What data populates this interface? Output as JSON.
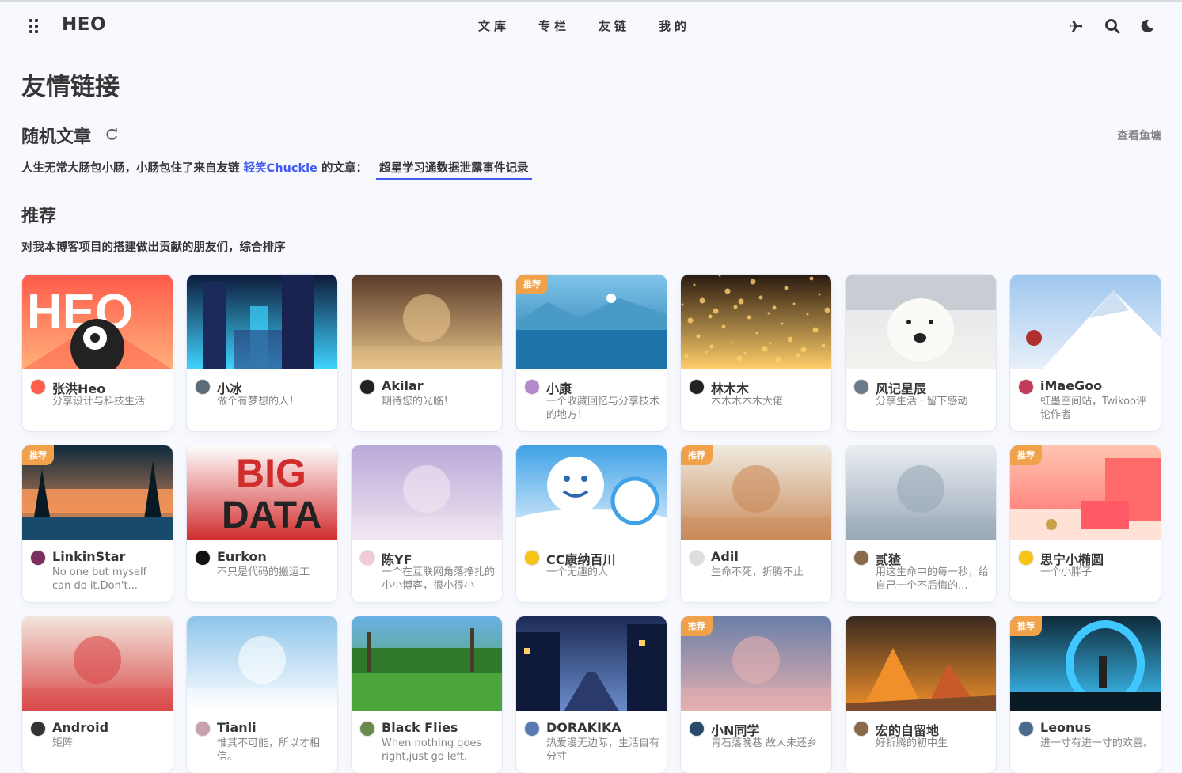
{
  "header": {
    "logo": "HEO",
    "nav": [
      "文库",
      "专栏",
      "友链",
      "我的"
    ]
  },
  "page": {
    "title": "友情链接",
    "random_section": {
      "title": "随机文章",
      "fish_link": "查看鱼塘",
      "line_prefix": "人生无常大肠包小肠，小肠包住了来自友链",
      "friend_name": "轻笑Chuckle",
      "line_mid": "的文章：",
      "article": "超星学习通数据泄露事件记录"
    },
    "recommend_section": {
      "title": "推荐",
      "desc": "对我本博客项目的搭建做出贡献的朋友们，综合排序"
    }
  },
  "badge_label": "推荐",
  "cards": [
    {
      "name": "张洪Heo",
      "desc": "分享设计与科技生活",
      "badge": false
    },
    {
      "name": "小冰",
      "desc": "做个有梦想的人！",
      "badge": false
    },
    {
      "name": "Akilar",
      "desc": "期待您的光临！",
      "badge": false
    },
    {
      "name": "小康",
      "desc": "一个收藏回忆与分享技术的地方！",
      "badge": true
    },
    {
      "name": "林木木",
      "desc": "木木木木木大佬",
      "badge": false
    },
    {
      "name": "风记星辰",
      "desc": "分享生活 · 留下感动",
      "badge": false
    },
    {
      "name": "iMaeGoo",
      "desc": "虹墨空间站，Twikoo评论作者",
      "badge": false
    },
    {
      "name": "LinkinStar",
      "desc": "No one but myself can do it.Don't...",
      "badge": true
    },
    {
      "name": "Eurkon",
      "desc": "不只是代码的搬运工",
      "badge": false
    },
    {
      "name": "陈YF",
      "desc": "一个在互联网角落挣扎的小小博客，很小很小",
      "badge": false
    },
    {
      "name": "CC康纳百川",
      "desc": "一个无趣的人",
      "badge": false
    },
    {
      "name": "Adil",
      "desc": "生命不死，折腾不止",
      "badge": true
    },
    {
      "name": "贰猹",
      "desc": "用这生命中的每一秒，给自己一个不后悔的...",
      "badge": false
    },
    {
      "name": "思宁小椭圆",
      "desc": "一个小胖子",
      "badge": true
    },
    {
      "name": "Android",
      "desc": "矩阵",
      "badge": false
    },
    {
      "name": "Tianli",
      "desc": "惟其不可能，所以才相信。",
      "badge": false
    },
    {
      "name": "Black Flies",
      "desc": "When nothing goes right,just go left.",
      "badge": false
    },
    {
      "name": "DORAKIKA",
      "desc": "热爱漫无边际，生活自有分寸",
      "badge": false
    },
    {
      "name": "小N同学",
      "desc": "青石落晚巷 故人未还乡",
      "badge": true
    },
    {
      "name": "宏的自留地",
      "desc": "好折腾的初中生",
      "badge": false
    },
    {
      "name": "Leonus",
      "desc": "进一寸有进一寸的欢喜。",
      "badge": true
    }
  ],
  "covers": [
    {
      "cover": "heo-logo",
      "colors": [
        "#ff5b4a",
        "#ffb07a"
      ]
    },
    {
      "cover": "city-night",
      "colors": [
        "#0d1a3a",
        "#3fd4ff"
      ]
    },
    {
      "cover": "anime-room",
      "colors": [
        "#5a3a2a",
        "#e8c58a"
      ]
    },
    {
      "cover": "lake-mountains",
      "colors": [
        "#7fc5ea",
        "#1e73a8"
      ]
    },
    {
      "cover": "bokeh-lights",
      "colors": [
        "#2a1a10",
        "#ffcf6a"
      ]
    },
    {
      "cover": "polar-bear",
      "colors": [
        "#dfe4ea",
        "#f4f2ee"
      ]
    },
    {
      "cover": "snow-mountain",
      "colors": [
        "#9fc7ee",
        "#e8f0fa"
      ]
    },
    {
      "cover": "forest-sunset",
      "colors": [
        "#0f2a3d",
        "#ff9a5a"
      ]
    },
    {
      "cover": "big-data",
      "colors": [
        "#ffffff",
        "#d12c2c"
      ]
    },
    {
      "cover": "anime-dancer",
      "colors": [
        "#b9a9d9",
        "#f1e6f2"
      ]
    },
    {
      "cover": "blue-mascot",
      "colors": [
        "#3fa2e6",
        "#e6f2fb"
      ]
    },
    {
      "cover": "cat-paper",
      "colors": [
        "#efeae0",
        "#c98a5a"
      ]
    },
    {
      "cover": "winged-piano",
      "colors": [
        "#e9edf1",
        "#9aa8b8"
      ]
    },
    {
      "cover": "pink-shapes",
      "colors": [
        "#ffc5b0",
        "#ff6a6a"
      ]
    },
    {
      "cover": "anime-party",
      "colors": [
        "#f2e6dc",
        "#d94a4a"
      ]
    },
    {
      "cover": "clouds-girl",
      "colors": [
        "#8ec5ea",
        "#ffffff"
      ]
    },
    {
      "cover": "green-park",
      "colors": [
        "#6ab0e6",
        "#4aa63a"
      ]
    },
    {
      "cover": "night-street",
      "colors": [
        "#1c2b55",
        "#6a8ccc"
      ]
    },
    {
      "cover": "anime-scarf",
      "colors": [
        "#6a7fa8",
        "#e6b0b0"
      ]
    },
    {
      "cover": "lowpoly-fox",
      "colors": [
        "#3a2a20",
        "#f0902a"
      ]
    },
    {
      "cover": "cyber-portal",
      "colors": [
        "#0f2a3a",
        "#3fc8ff"
      ]
    }
  ]
}
